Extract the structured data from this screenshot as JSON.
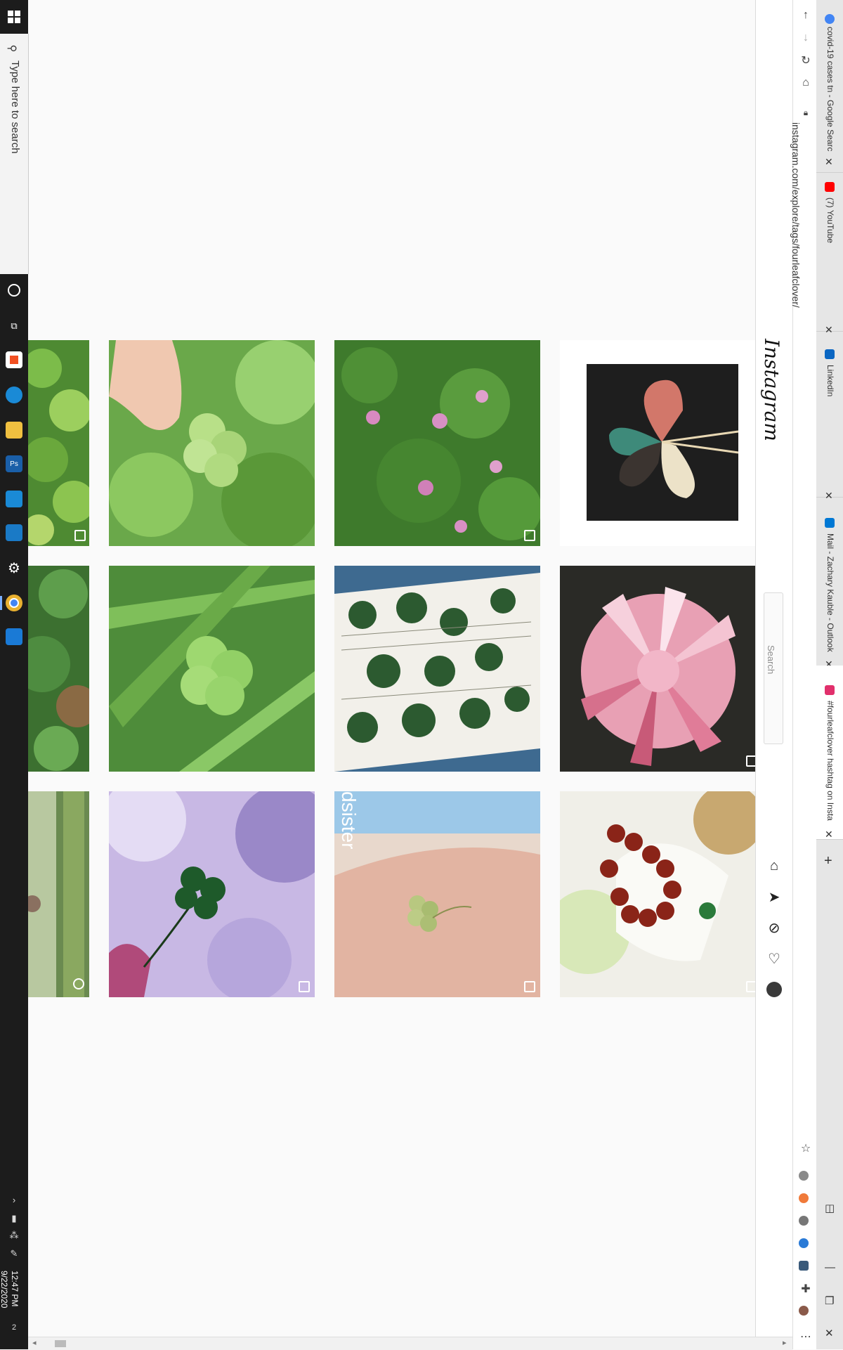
{
  "taskbar": {
    "search_placeholder": "Type here to search",
    "time": "12:47 PM",
    "date": "9/22/2020",
    "notification_count": "2",
    "pinned_apps": [
      "cortana-icon",
      "task-view-icon",
      "store-icon",
      "edge-icon",
      "file-explorer-icon",
      "photoshop-icon",
      "azure-icon",
      "remote-desktop-icon",
      "settings-icon",
      "chrome-icon",
      "vscode-icon"
    ]
  },
  "browser": {
    "tabs": [
      {
        "title": "covid-19 cases tn - Google Searc",
        "color": "#4285f4"
      },
      {
        "title": "(7) YouTube",
        "color": "#ff0000"
      },
      {
        "title": "LinkedIn",
        "color": "#0a66c2"
      },
      {
        "title": "Mail - Zachary Kauble - Outlook",
        "color": "#0078d4"
      },
      {
        "title": "#fourleafclover hashtag on Insta",
        "color": "#e1306c"
      }
    ],
    "url": "instagram.com/explore/tags/fourleafclover/"
  },
  "instagram": {
    "logo": "Instagram",
    "search_placeholder": "Search"
  },
  "posts": [
    {
      "desc": "clover patch",
      "overlay": "multi"
    },
    {
      "desc": "hand picking four leaf clover",
      "overlay": ""
    },
    {
      "desc": "clover field with pink flowers",
      "overlay": "multi"
    },
    {
      "desc": "clover shaped spoons",
      "overlay": ""
    },
    {
      "desc": "clover leaves",
      "overlay": ""
    },
    {
      "desc": "four leaf clover in grass",
      "overlay": ""
    },
    {
      "desc": "pressed clovers on book page",
      "overlay": ""
    },
    {
      "desc": "pink clover flower",
      "overlay": "multi"
    },
    {
      "desc": "fence post",
      "overlay": "igtv"
    },
    {
      "desc": "four leaf clover against sky",
      "overlay": "multi"
    },
    {
      "desc": "clover tattoo",
      "overlay": "multi"
    },
    {
      "desc": "garnet bracelet",
      "overlay": "multi"
    }
  ],
  "tattoo_watermark": "dsister"
}
